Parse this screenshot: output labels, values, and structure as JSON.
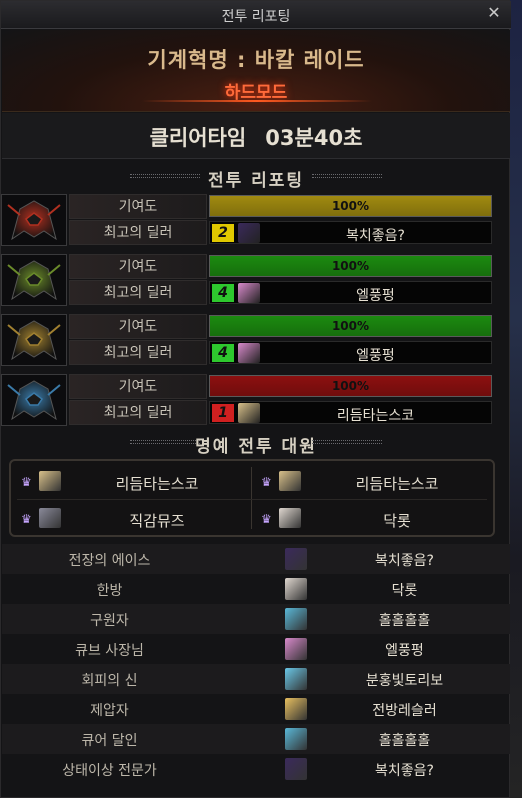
{
  "window": {
    "title": "전투 리포팅",
    "close_glyph": "✕"
  },
  "header": {
    "raid_name": "기계혁명 : 바칼 레이드",
    "difficulty": "하드모드"
  },
  "clear_time": {
    "label": "클리어타임",
    "value": "03분40초"
  },
  "report_section": {
    "title": "전투 리포팅"
  },
  "row_labels": {
    "contribution": "기여도",
    "best_dealer": "최고의 딜러"
  },
  "players": [
    {
      "portrait": "red-flame-helm-icon",
      "accent": "#b03020",
      "contribution_text": "100%",
      "contribution_value": 100,
      "bar_color": "#a08a10",
      "dealer_rank": "2",
      "dealer_rank_color": "#e0c800",
      "dealer_name": "복치좋음?",
      "dealer_avatar_color": "#3b2a5c"
    },
    {
      "portrait": "green-horn-helm-icon",
      "accent": "#6a8a2a",
      "contribution_text": "100%",
      "contribution_value": 100,
      "bar_color": "#1c8a10",
      "dealer_rank": "4",
      "dealer_rank_color": "#2ec82e",
      "dealer_name": "엘풍펑",
      "dealer_avatar_color": "#d88acb"
    },
    {
      "portrait": "gold-horn-helm-icon",
      "accent": "#a08030",
      "contribution_text": "100%",
      "contribution_value": 100,
      "bar_color": "#1c8a10",
      "dealer_rank": "4",
      "dealer_rank_color": "#2ec82e",
      "dealer_name": "엘풍펑",
      "dealer_avatar_color": "#d88acb"
    },
    {
      "portrait": "blue-horn-helm-icon",
      "accent": "#3a7aa8",
      "contribution_text": "100%",
      "contribution_value": 100,
      "bar_color": "#8c1010",
      "dealer_rank": "1",
      "dealer_rank_color": "#d02020",
      "dealer_name": "리듬타는스코",
      "dealer_avatar_color": "#d8c08a"
    }
  ],
  "mvp_section": {
    "title": "명예 전투 대원",
    "members": [
      {
        "name": "리듬타는스코",
        "avatar_color": "#d8c08a"
      },
      {
        "name": "리듬타는스코",
        "avatar_color": "#d8c08a"
      },
      {
        "name": "직감뮤즈",
        "avatar_color": "#8a8a9a"
      },
      {
        "name": "닥롯",
        "avatar_color": "#e0d8d0"
      }
    ]
  },
  "awards": [
    {
      "award": "전장의 에이스",
      "player": "복치좋음?",
      "avatar_color": "#3b2a5c"
    },
    {
      "award": "한방",
      "player": "닥롯",
      "avatar_color": "#e0d8d0"
    },
    {
      "award": "구원자",
      "player": "홀홀홀홀",
      "avatar_color": "#5ab8d8"
    },
    {
      "award": "큐브 사장님",
      "player": "엘풍펑",
      "avatar_color": "#d88acb"
    },
    {
      "award": "회피의 신",
      "player": "분홍빛토리보",
      "avatar_color": "#6ac8e8"
    },
    {
      "award": "제압자",
      "player": "전방레슬러",
      "avatar_color": "#e8c060"
    },
    {
      "award": "큐어 달인",
      "player": "홀홀홀홀",
      "avatar_color": "#5ab8d8"
    },
    {
      "award": "상태이상 전문가",
      "player": "복치좋음?",
      "avatar_color": "#3b2a5c"
    }
  ]
}
